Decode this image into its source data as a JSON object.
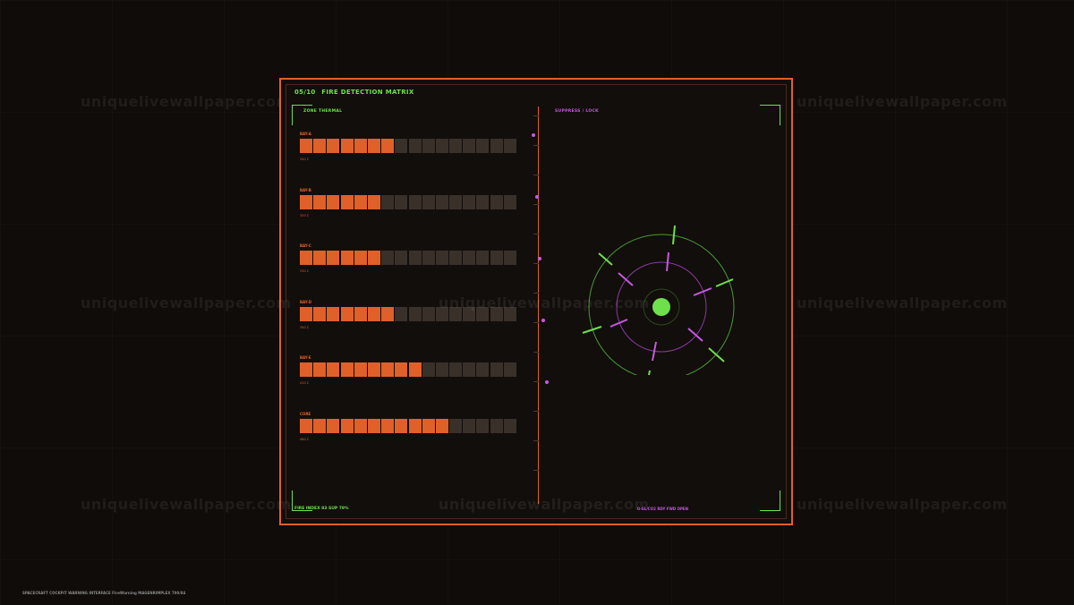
{
  "header": {
    "index": "05/10",
    "title": "FIRE DETECTION MATRIX"
  },
  "left_section": {
    "label": "ZONE THERMAL"
  },
  "right_section": {
    "label": "SUPPRESS / LOCK"
  },
  "bays": [
    {
      "label": "BAY-A",
      "temp": "340 C",
      "filled": 7,
      "total": 16
    },
    {
      "label": "BAY-B",
      "temp": "320 C",
      "filled": 6,
      "total": 16
    },
    {
      "label": "BAY-C",
      "temp": "330 C",
      "filled": 6,
      "total": 16
    },
    {
      "label": "BAY-D",
      "temp": "340 C",
      "filled": 7,
      "total": 16
    },
    {
      "label": "BAY-E",
      "temp": "410 C",
      "filled": 9,
      "total": 16
    },
    {
      "label": "CORE",
      "temp": "460 C",
      "filled": 11,
      "total": 16
    }
  ],
  "footer": {
    "left": "FIRE INDEX 83  SUP 79%",
    "right": "O-SL/CO2 RDY FWD  OPEN"
  },
  "watermark": "uniquelivewallpaper.com",
  "credit": "SPACECRAFT COCKPIT WARNING INTERFACE  FireWarning  MAGENRIMPLEX  700/84",
  "colors": {
    "accent_orange": "#e0602a",
    "accent_green": "#6ee04c",
    "accent_purple": "#c45ae0",
    "background": "#0f0c09"
  }
}
